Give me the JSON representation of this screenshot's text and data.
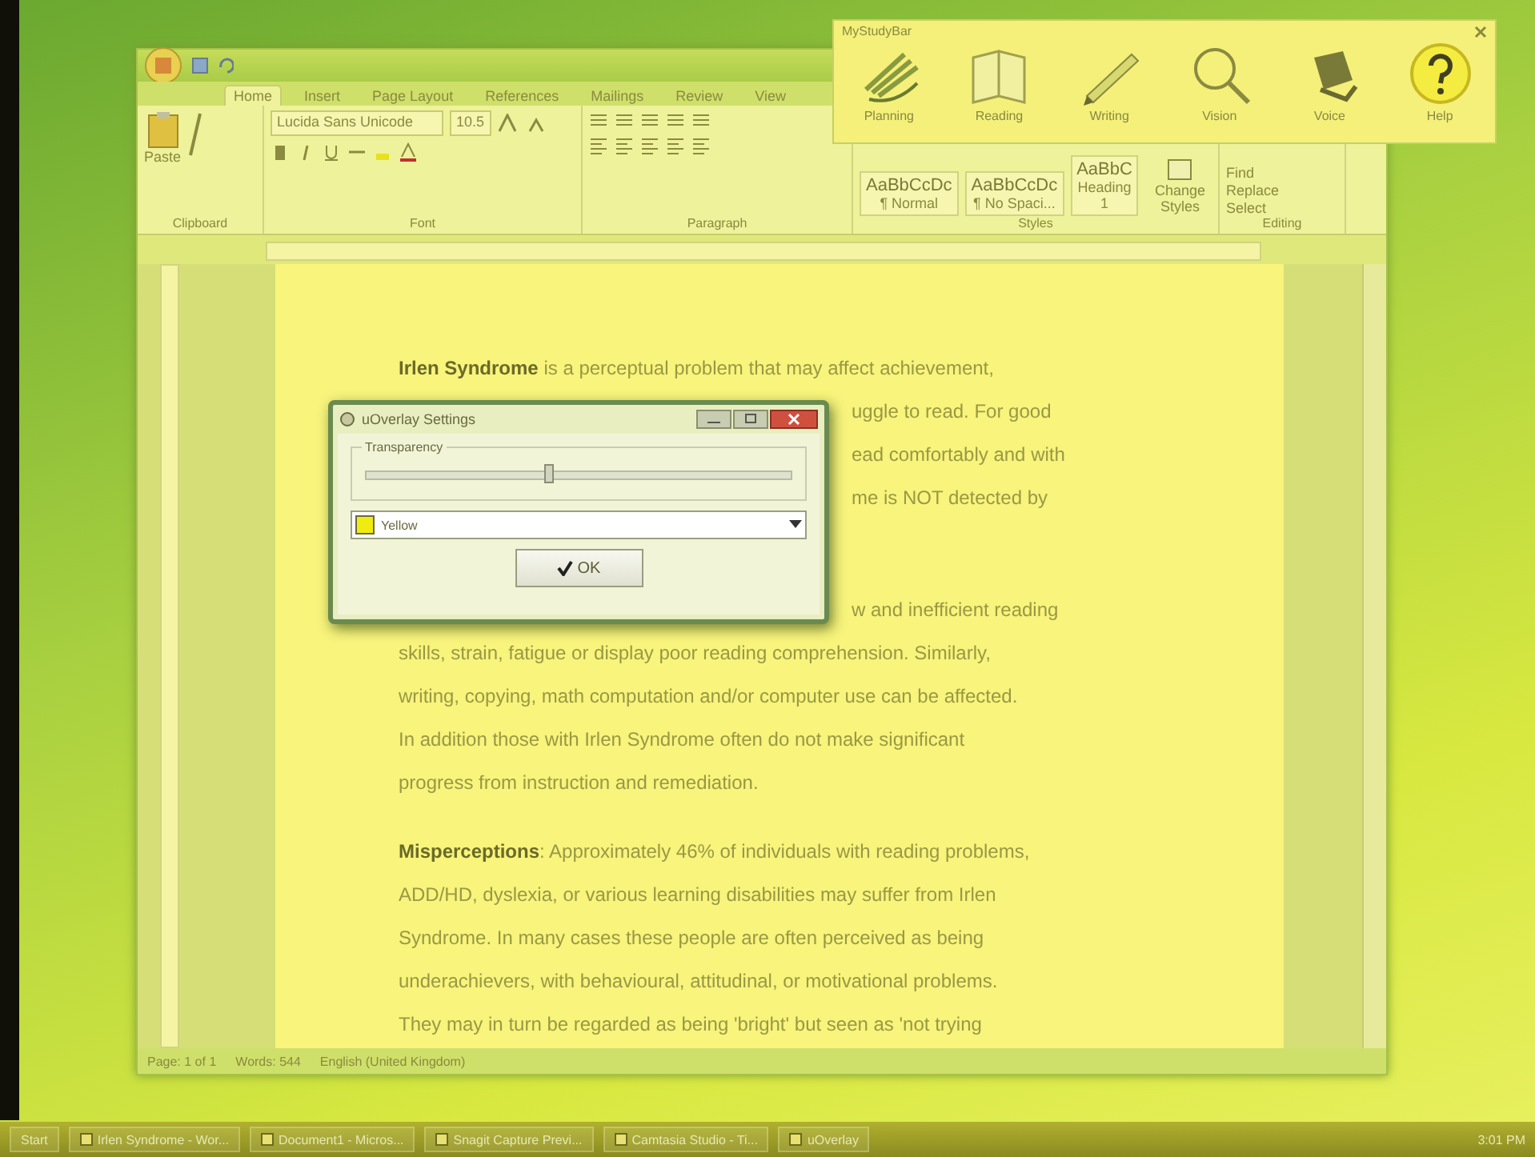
{
  "word_window": {
    "ribbon_tabs": [
      {
        "label": "Home",
        "selected": true
      },
      {
        "label": "Insert",
        "selected": false
      },
      {
        "label": "Page Layout",
        "selected": false
      },
      {
        "label": "References",
        "selected": false
      },
      {
        "label": "Mailings",
        "selected": false
      },
      {
        "label": "Review",
        "selected": false
      },
      {
        "label": "View",
        "selected": false
      }
    ],
    "paste_label": "Paste",
    "font": {
      "name": "Lucida Sans Unicode",
      "size": "10.5"
    },
    "ribbon_groups": [
      "Clipboard",
      "Font",
      "Paragraph",
      "Styles",
      "Editing"
    ],
    "styles": [
      {
        "sample": "AaBbCcDc",
        "name": "¶ Normal"
      },
      {
        "sample": "AaBbCcDc",
        "name": "¶ No Spaci..."
      },
      {
        "sample": "AaBbC",
        "name": "Heading 1"
      }
    ],
    "change_styles": "Change Styles",
    "editing": [
      "Find",
      "Replace",
      "Select"
    ],
    "document": {
      "paragraphs": [
        {
          "lines": [
            {
              "kind": "full",
              "text": "**Irlen Syndrome** is a perceptual problem that may affect achievement,"
            },
            {
              "kind": "partial",
              "text": "uggle to read. For good"
            },
            {
              "kind": "partial",
              "text": "ead comfortably and with"
            },
            {
              "kind": "partial",
              "text": "me is NOT detected by"
            }
          ]
        },
        {
          "lines": [
            {
              "kind": "partial",
              "text": "w and inefficient reading"
            },
            {
              "kind": "full",
              "text": "skills, strain, fatigue or display poor reading comprehension. Similarly,"
            },
            {
              "kind": "full",
              "text": "writing, copying, math computation and/or computer use can be affected."
            },
            {
              "kind": "full",
              "text": "In addition those with Irlen Syndrome often do not make significant"
            },
            {
              "kind": "full",
              "text": "progress from instruction and remediation."
            }
          ]
        },
        {
          "lines": [
            {
              "kind": "full",
              "text": "**Misperceptions**: Approximately 46% of individuals with reading problems,"
            },
            {
              "kind": "full",
              "text": "ADD/HD, dyslexia, or various learning disabilities may suffer from Irlen"
            },
            {
              "kind": "full",
              "text": "Syndrome. In many cases these people are often perceived as being"
            },
            {
              "kind": "full",
              "text": "underachievers, with behavioural, attitudinal, or motivational problems."
            },
            {
              "kind": "full",
              "text": "They may in turn be regarded as being 'bright' but seen as 'not trying"
            }
          ]
        }
      ]
    },
    "status_bar": [
      "Page: 1 of 1",
      "Words: 544",
      "English (United Kingdom)"
    ]
  },
  "study_bar": {
    "title": "MyStudyBar",
    "tools": [
      {
        "kind": "planning",
        "label": "Planning"
      },
      {
        "kind": "reading",
        "label": "Reading"
      },
      {
        "kind": "writing",
        "label": "Writing"
      },
      {
        "kind": "vision",
        "label": "Vision"
      },
      {
        "kind": "voice",
        "label": "Voice"
      },
      {
        "kind": "help",
        "label": "Help"
      }
    ]
  },
  "dialog": {
    "title": "uOverlay Settings",
    "group": "Transparency",
    "transparency": {
      "level": 0.43
    },
    "overlay_color": {
      "label": "Yellow",
      "color": "#f0ec10"
    },
    "ok": "OK"
  },
  "taskbar": {
    "start": "Start",
    "tasks": [
      "Irlen Syndrome - Wor...",
      "Document1 - Micros...",
      "Snagit Capture Previ...",
      "Camtasia Studio - Ti...",
      "uOverlay"
    ],
    "clock": "3:01 PM"
  }
}
